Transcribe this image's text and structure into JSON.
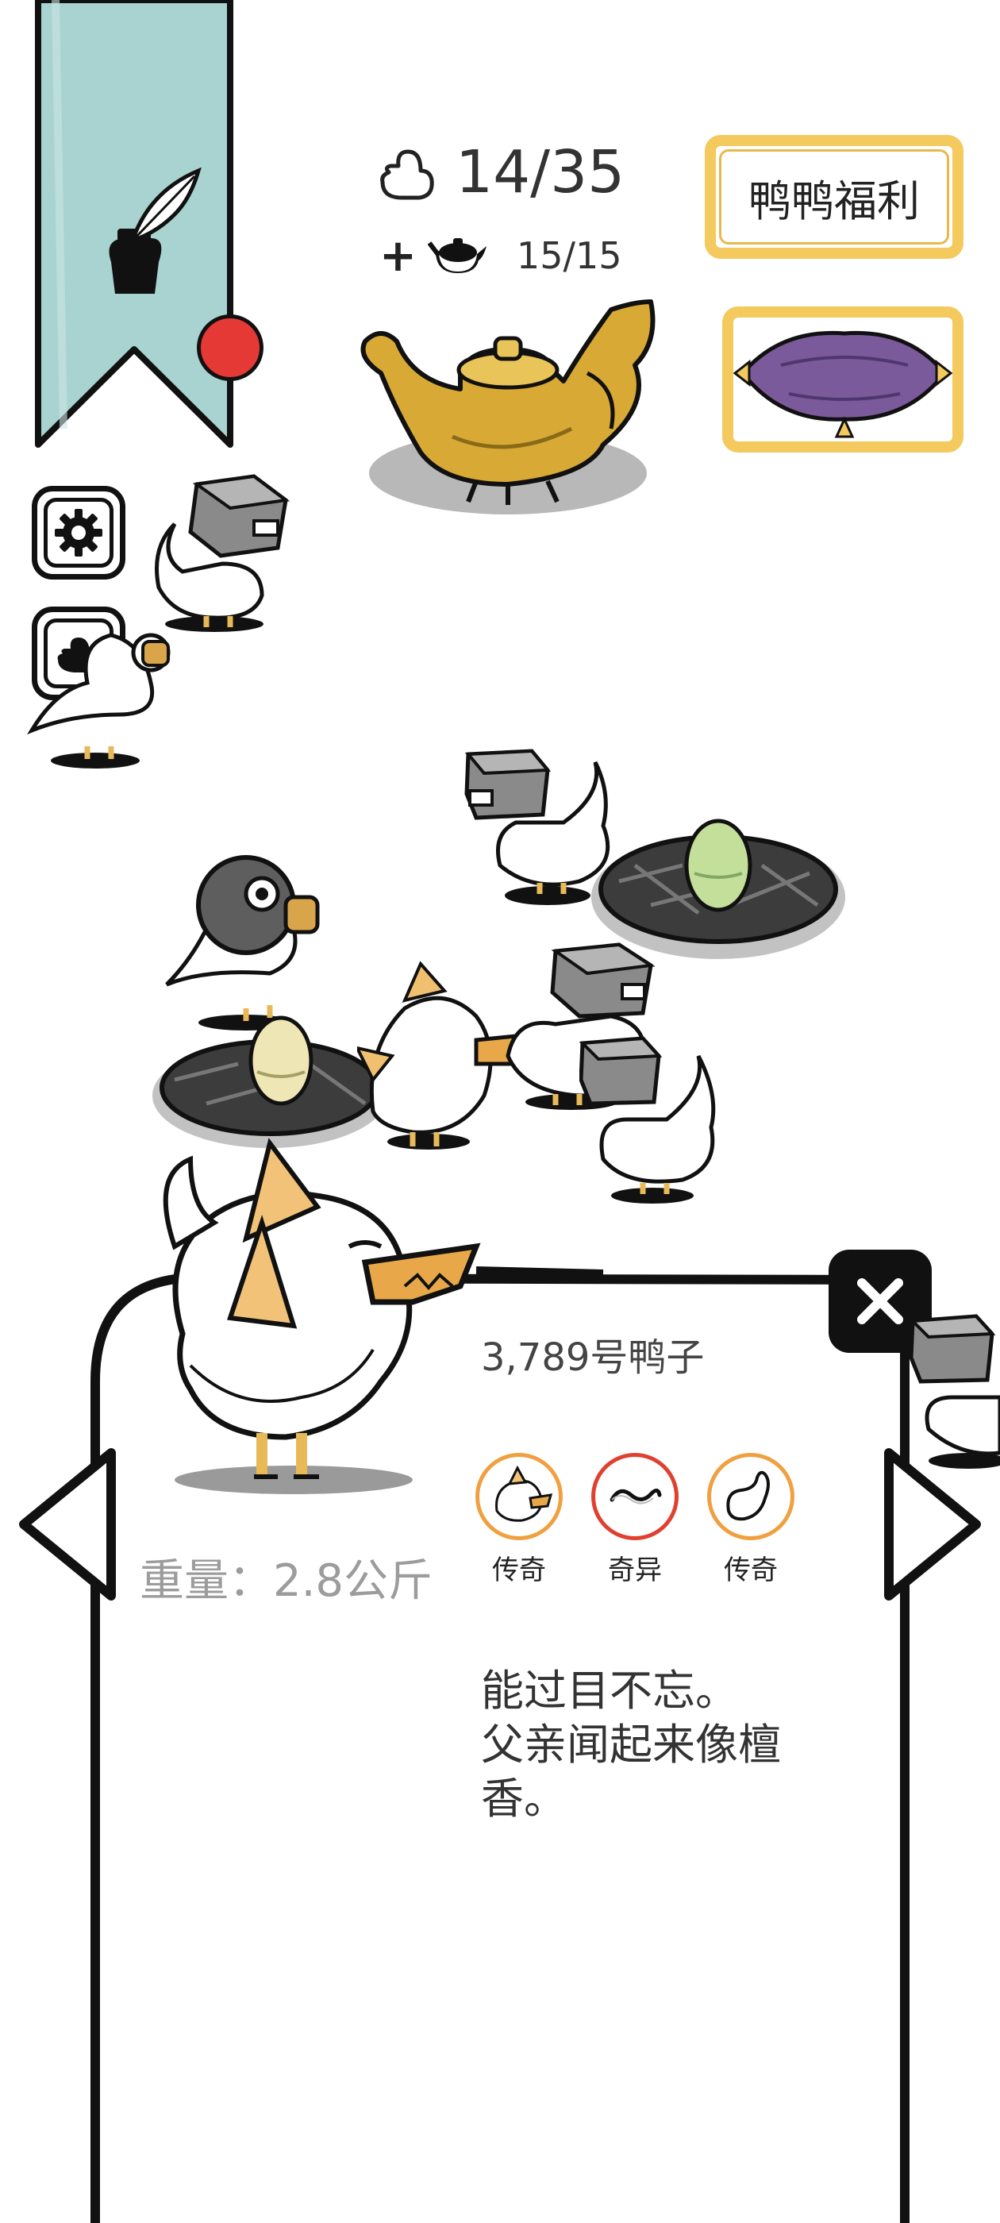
{
  "header": {
    "duck_count": "14/35",
    "tea_plus": "+",
    "tea_count": "15/15",
    "welfare_label": "鸭鸭福利"
  },
  "colors": {
    "banner": "#a8d3d0",
    "accent_yellow": "#f4c95d",
    "red_dot": "#e53935",
    "legendary_ring": "#f0a040",
    "strange_ring": "#e04030",
    "teapot_gold": "#d8aa35",
    "cushion_purple": "#7a5a9a"
  },
  "icons": {
    "banner": "quill-inkpot-icon",
    "settings": "gear-icon",
    "collection": "duck-silhouette-icon",
    "close": "close-icon",
    "prev": "left-arrow-icon",
    "next": "right-arrow-icon"
  },
  "duck_info": {
    "name": "3,789号鸭子",
    "weight": "重量：2.8公斤",
    "traits": [
      {
        "icon": "dragon-duck-icon",
        "label": "传奇",
        "rarity": "legendary"
      },
      {
        "icon": "worm-icon",
        "label": "奇异",
        "rarity": "strange"
      },
      {
        "icon": "tail-icon",
        "label": "传奇",
        "rarity": "legendary"
      }
    ],
    "description_lines": [
      "能过目不忘。",
      "父亲闻起来像檀",
      "香。"
    ]
  }
}
